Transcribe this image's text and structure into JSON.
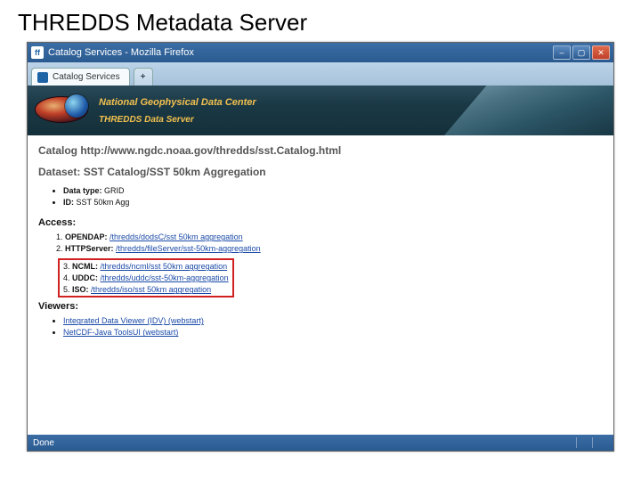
{
  "slide_title": "THREDDS Metadata Server",
  "window": {
    "title": "Catalog Services - Mozilla Firefox",
    "tab_label": "Catalog Services",
    "status": "Done"
  },
  "banner": {
    "line1": "National Geophysical Data Center",
    "line2": "THREDDS Data Server"
  },
  "catalog": {
    "prefix": "Catalog ",
    "url": "http://www.ngdc.noaa.gov/thredds/sst.Catalog.html"
  },
  "dataset": {
    "prefix": "Dataset: ",
    "name": "SST Catalog/SST 50km Aggregation"
  },
  "meta": [
    {
      "label": "Data type:",
      "value": "GRID"
    },
    {
      "label": "ID:",
      "value": "SST 50km Agg"
    }
  ],
  "access_title": "Access:",
  "access": [
    {
      "label": "OPENDAP:",
      "link": "/thredds/dodsC/sst 50km aggregation"
    },
    {
      "label": "HTTPServer:",
      "link": "/thredds/fileServer/sst-50km-aggregation"
    },
    {
      "label": "NCML:",
      "link": "/thredds/ncml/sst 50km aggregation"
    },
    {
      "label": "UDDC:",
      "link": "/thredds/uddc/sst-50km-aggregation"
    },
    {
      "label": "ISO:",
      "link": "/thredds/iso/sst 50km aggregation"
    }
  ],
  "viewers_title": "Viewers:",
  "viewers": [
    "Integrated Data Viewer (IDV) (webstart)",
    "NetCDF-Java ToolsUI (webstart)"
  ]
}
